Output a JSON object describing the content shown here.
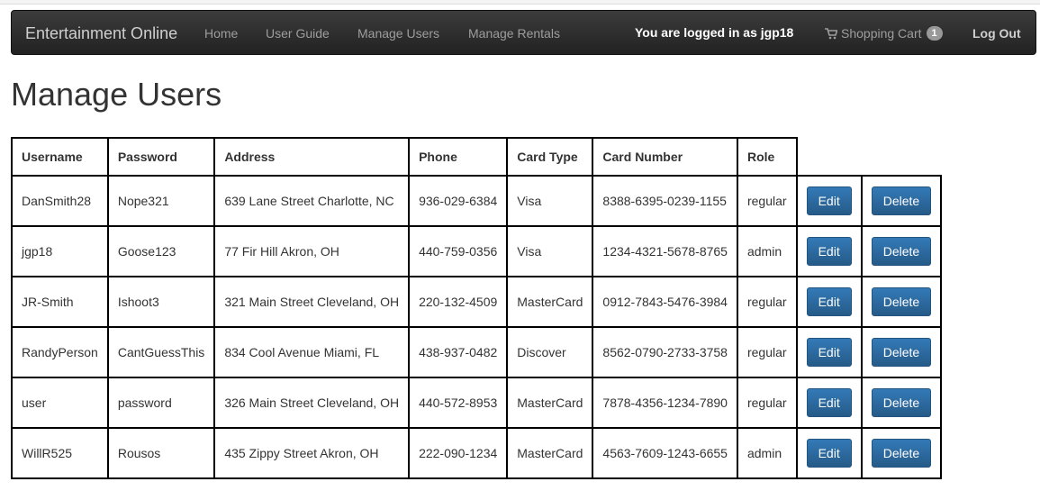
{
  "navbar": {
    "brand": "Entertainment Online",
    "links": [
      "Home",
      "User Guide",
      "Manage Users",
      "Manage Rentals"
    ],
    "logged_in": "You are logged in as jgp18",
    "cart_label": "Shopping Cart",
    "cart_count": "1",
    "logout": "Log Out"
  },
  "page_title": "Manage Users",
  "table": {
    "headers": [
      "Username",
      "Password",
      "Address",
      "Phone",
      "Card Type",
      "Card Number",
      "Role"
    ],
    "edit_label": "Edit",
    "delete_label": "Delete",
    "rows": [
      [
        "DanSmith28",
        "Nope321",
        "639 Lane Street Charlotte, NC",
        "936-029-6384",
        "Visa",
        "8388-6395-0239-1155",
        "regular"
      ],
      [
        "jgp18",
        "Goose123",
        "77 Fir Hill Akron, OH",
        "440-759-0356",
        "Visa",
        "1234-4321-5678-8765",
        "admin"
      ],
      [
        "JR-Smith",
        "Ishoot3",
        "321 Main Street Cleveland, OH",
        "220-132-4509",
        "MasterCard",
        "0912-7843-5476-3984",
        "regular"
      ],
      [
        "RandyPerson",
        "CantGuessThis",
        "834 Cool Avenue Miami, FL",
        "438-937-0482",
        "Discover",
        "8562-0790-2733-3758",
        "regular"
      ],
      [
        "user",
        "password",
        "326 Main Street Cleveland, OH",
        "440-572-8953",
        "MasterCard",
        "7878-4356-1234-7890",
        "regular"
      ],
      [
        "WillR525",
        "Rousos",
        "435 Zippy Street Akron, OH",
        "222-090-1234",
        "MasterCard",
        "4563-7609-1243-6655",
        "admin"
      ]
    ]
  },
  "icons": {
    "cart": "shopping-cart-icon"
  }
}
